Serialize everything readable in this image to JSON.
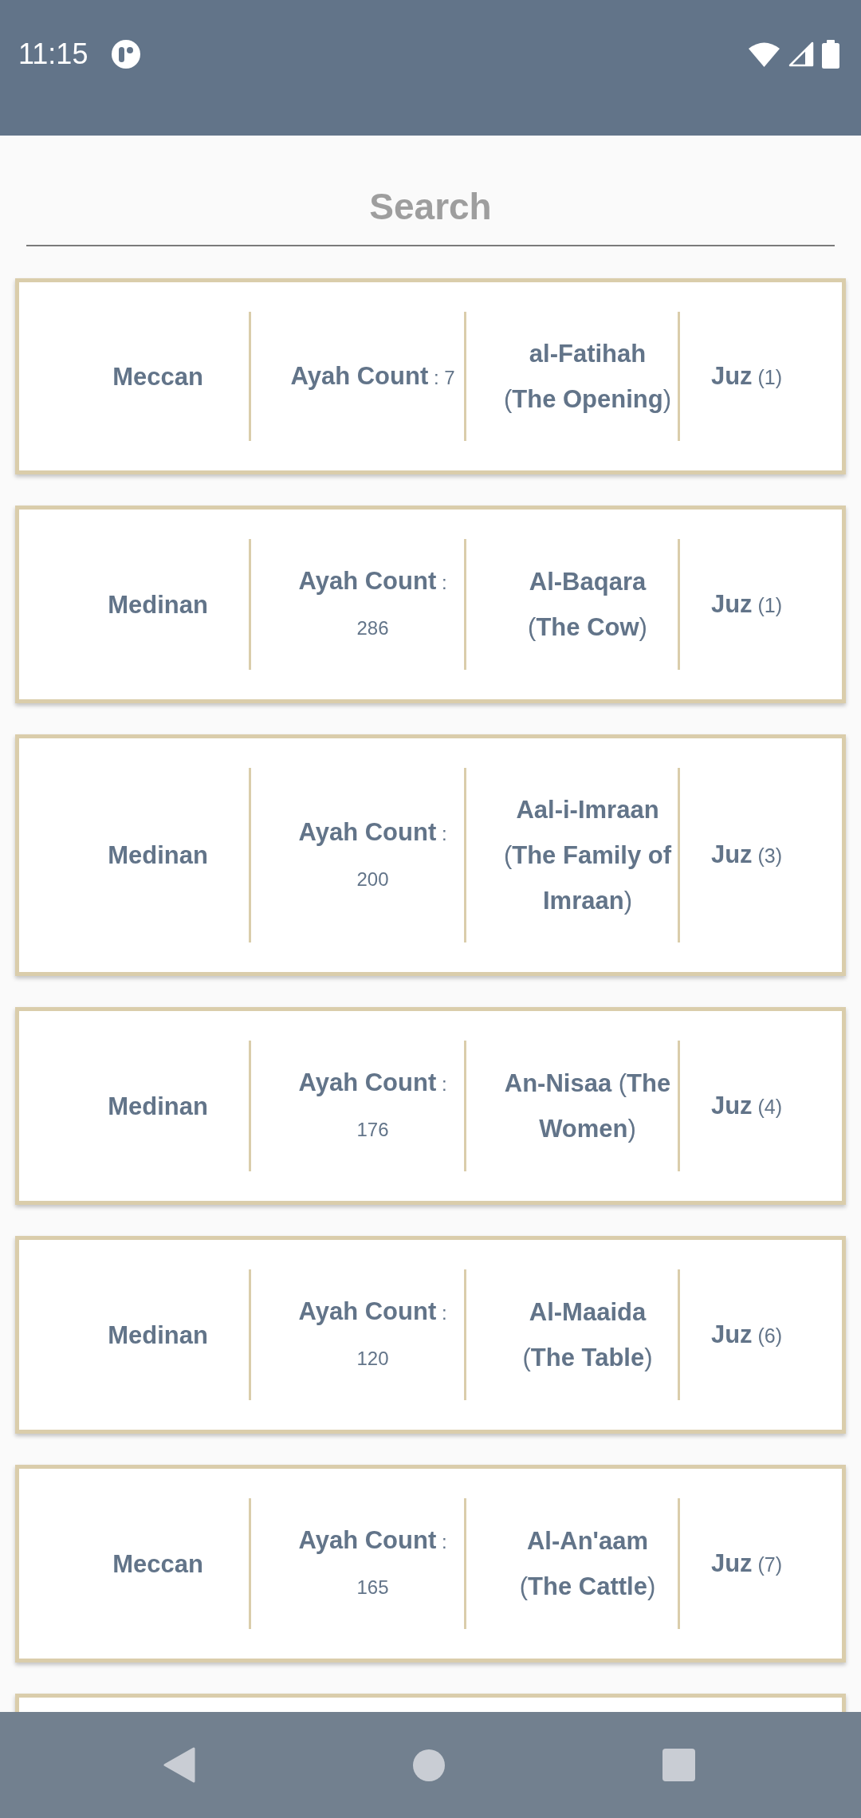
{
  "status_bar": {
    "time": "11:15"
  },
  "search": {
    "placeholder": "Search"
  },
  "surahs": [
    {
      "kind": "surah",
      "revelation": "Meccan",
      "ayah_count": "**Ayah Count** : 7",
      "name": "**al-Fatihah** (**The Opening**)",
      "juz": "**Juz** (1)"
    },
    {
      "kind": "surah",
      "revelation": "Medinan",
      "ayah_count": "**Ayah Count** : 286",
      "name": "**Al-Baqara** (**The Cow**)",
      "juz": "**Juz** (1)"
    },
    {
      "kind": "surah",
      "revelation": "Medinan",
      "ayah_count": "**Ayah Count** : 200",
      "name": "**Aal-i-Imraan** (**The Family of Imraan**)",
      "juz": "**Juz** (3)"
    },
    {
      "kind": "surah",
      "revelation": "Medinan",
      "ayah_count": "**Ayah Count** : 176",
      "name": "**An-Nisaa** (**The Women**)",
      "juz": "**Juz** (4)"
    },
    {
      "kind": "surah",
      "revelation": "Medinan",
      "ayah_count": "**Ayah Count** : 120",
      "name": "**Al-Maaida** (**The Table**)",
      "juz": "**Juz** (6)"
    },
    {
      "kind": "surah",
      "revelation": "Meccan",
      "ayah_count": "**Ayah Count** : 165",
      "name": "**Al-An'aam** (**The Cattle**)",
      "juz": "**Juz** (7)"
    },
    {
      "kind": "clipped"
    }
  ]
}
